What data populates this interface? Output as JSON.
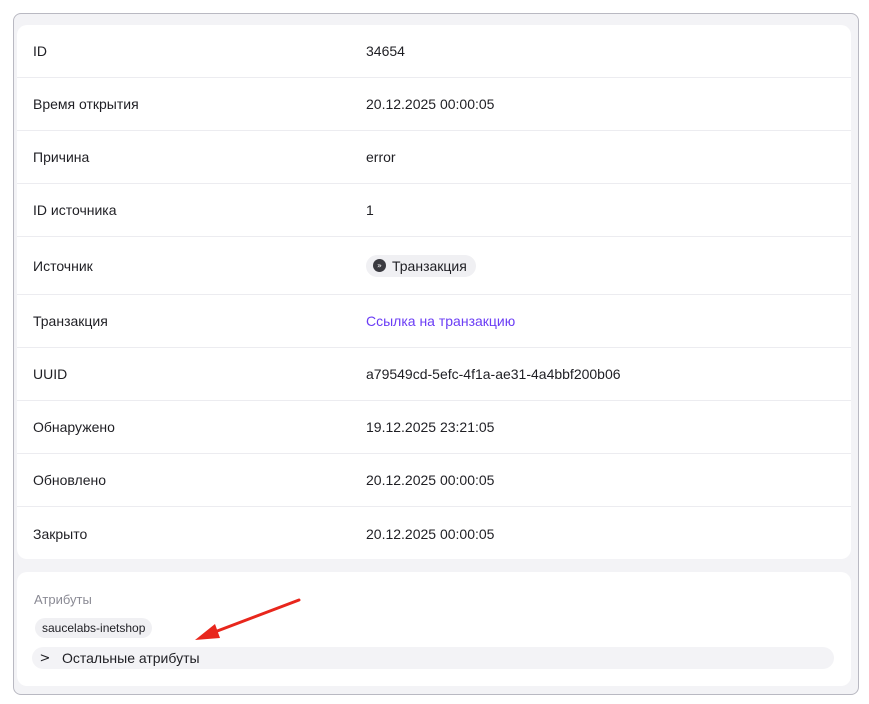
{
  "details": {
    "rows": [
      {
        "label": "ID",
        "value": "34654"
      },
      {
        "label": "Время открытия",
        "value": "20.12.2025 00:00:05"
      },
      {
        "label": "Причина",
        "value": "error"
      },
      {
        "label": "ID источника",
        "value": "1"
      },
      {
        "label": "Источник",
        "value": "Транзакция",
        "icon": "chevrons-right-icon"
      },
      {
        "label": "Транзакция",
        "value": "Ссылка на транзакцию"
      },
      {
        "label": "UUID",
        "value": "a79549cd-5efc-4f1a-ae31-4a4bbf200b06"
      },
      {
        "label": "Обнаружено",
        "value": "19.12.2025 23:21:05"
      },
      {
        "label": "Обновлено",
        "value": "20.12.2025 00:00:05"
      },
      {
        "label": "Закрыто",
        "value": "20.12.2025 00:00:05"
      }
    ]
  },
  "attributes": {
    "title": "Атрибуты",
    "tag": "saucelabs-inetshop",
    "expander_label": "Остальные атрибуты",
    "expander_icon": "chevron-right-icon"
  },
  "colors": {
    "link": "#6b3df5",
    "annotation_arrow": "#e8261c"
  }
}
